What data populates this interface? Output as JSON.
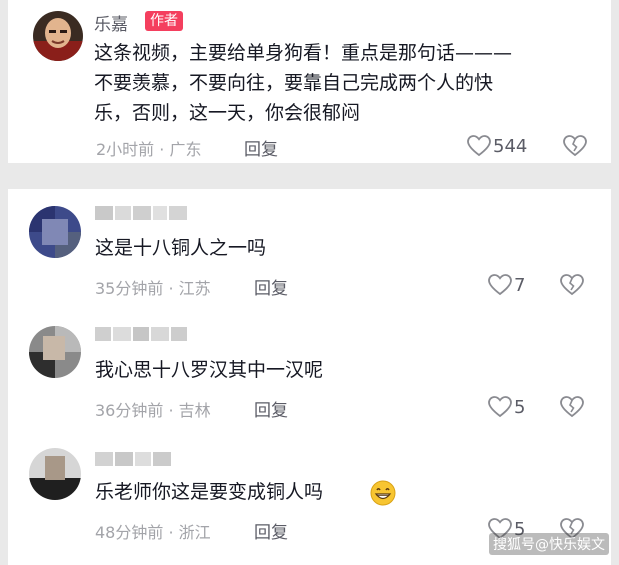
{
  "colors": {
    "page_background": "#e9e9e9",
    "card_background": "#ffffff",
    "author_badge": "#f43f5e",
    "text_primary": "#161823",
    "text_secondary": "#a3a4a9"
  },
  "top_comment": {
    "user_name": "乐嘉",
    "badge": "作者",
    "text_lines": [
      "这条视频，主要给单身狗看！重点是那句话———",
      "不要羡慕，不要向往，要靠自己完成两个人的快",
      "乐，否则，这一天，你会很郁闷"
    ],
    "meta": "2小时前 · 广东",
    "reply_label": "回复",
    "like_count": "544",
    "like_icon": "heart-outline-icon",
    "dislike_icon": "broken-heart-icon"
  },
  "comments": [
    {
      "text": "这是十八铜人之一吗",
      "meta": "35分钟前 · 江苏",
      "reply_label": "回复",
      "like_count": "7"
    },
    {
      "text": "我心思十八罗汉其中一汉呢",
      "meta": "36分钟前 · 吉林",
      "reply_label": "回复",
      "like_count": "5"
    },
    {
      "text": "乐老师你这是要变成铜人吗",
      "meta": "48分钟前 · 浙江",
      "reply_label": "回复",
      "like_count": "5",
      "emoji": "grinning-face-emoji"
    }
  ],
  "watermark": "搜狐号@快乐娱文"
}
